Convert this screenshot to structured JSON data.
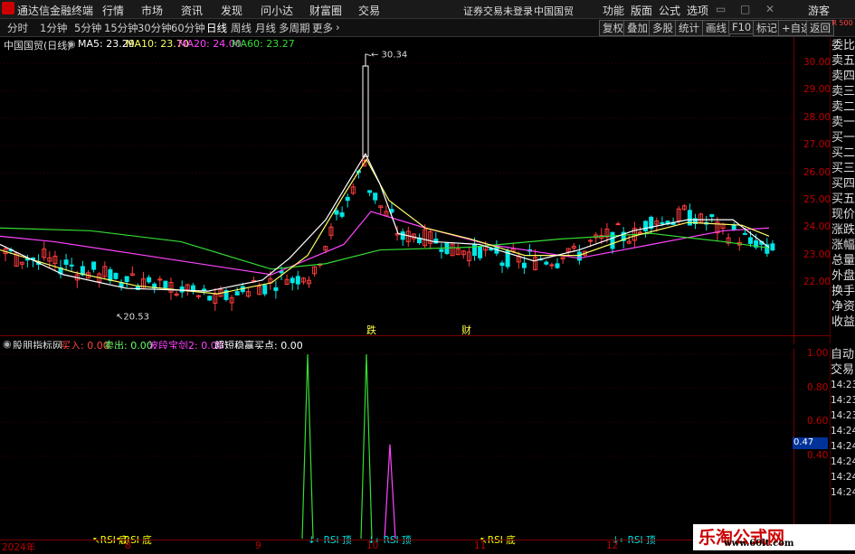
{
  "menubar": {
    "app_title": "通达信金融终端",
    "menus": [
      "行情",
      "市场",
      "资讯",
      "发现",
      "问小达",
      "财富圈",
      "交易"
    ],
    "status": "证券交易未登录",
    "stock": "中国国贸",
    "right_menus": [
      "功能",
      "版面",
      "公式",
      "选项"
    ],
    "user": "游客"
  },
  "toolbar": {
    "periods": [
      "分时",
      "1分钟",
      "5分钟",
      "15分钟",
      "30分钟",
      "60分钟",
      "日线",
      "周线",
      "月线",
      "多周期",
      "更多"
    ],
    "active_period": "日线",
    "buttons": [
      "复权",
      "叠加",
      "多股",
      "统计",
      "画线",
      "F10",
      "标记",
      "+自选",
      "返回"
    ]
  },
  "main_legend": {
    "title": "中国国贸(日线)",
    "ma5": "MA5: 23.29",
    "ma10": "MA10: 23.70",
    "ma20": "MA20: 24.00",
    "ma60": "MA60: 23.27"
  },
  "price_axis": [
    "30.00",
    "29.00",
    "28.00",
    "27.00",
    "26.00",
    "25.00",
    "24.00",
    "23.00",
    "22.00"
  ],
  "annotations": {
    "high": "30.34",
    "low": "20.53",
    "die": "跌",
    "cai": "财"
  },
  "indicator_legend": {
    "name": "股朋指标网",
    "buy": "买入: 0.00",
    "sell": "卖出: 0.00",
    "wave": "波段宝剑2: 0.00",
    "super": "超短稳赢买点: 0.00"
  },
  "ind_axis": [
    "1.00",
    "0.80",
    "0.60",
    "0.40"
  ],
  "ind_current": "0.47",
  "signals": [
    "↖RSI 底",
    "↖RSI 底",
    "↓←RSI 顶",
    "↓←RSI 顶",
    "↖RSI 底",
    "↓←RSI 顶"
  ],
  "date_axis": [
    "2024年",
    "8",
    "9",
    "10",
    "11",
    "12"
  ],
  "right_panel": [
    "委比",
    "卖五",
    "卖四",
    "卖三",
    "卖二",
    "卖一",
    "买一",
    "买二",
    "买三",
    "买四",
    "买五",
    "现价",
    "涨跌",
    "涨幅",
    "总量",
    "外盘",
    "换手",
    "净资",
    "收益"
  ],
  "right_panel2": [
    "自动",
    "交易",
    "14:23",
    "14:23",
    "14:23",
    "14:24",
    "14:24",
    "14:24",
    "14:24",
    "14:24"
  ],
  "top_right_badge": "R 500",
  "watermark": {
    "title": "乐淘公式网",
    "url": "www.60lt.com"
  },
  "colors": {
    "up": "#ff3d3d",
    "down": "#00e5e5",
    "ma5": "#ffffff",
    "ma10": "#ffff66",
    "ma20": "#ff44ff",
    "ma60": "#33dd33",
    "grid": "#5a0000"
  },
  "chart_data": {
    "type": "line",
    "title": "",
    "series": [
      {
        "name": "MA5",
        "values": [
          23.29
        ]
      },
      {
        "name": "MA10",
        "values": [
          23.7
        ]
      },
      {
        "name": "MA20",
        "values": [
          24.0
        ]
      },
      {
        "name": "MA60",
        "values": [
          23.27
        ]
      }
    ],
    "ylim": [
      21.2,
      30.5
    ]
  }
}
